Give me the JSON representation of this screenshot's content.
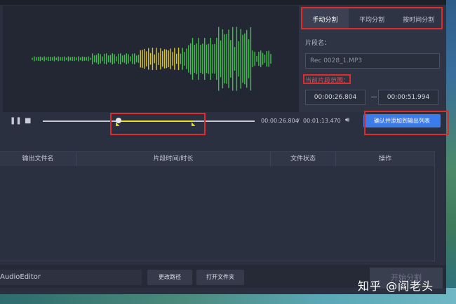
{
  "tabs": [
    {
      "label": "手动分割",
      "active": true
    },
    {
      "label": "平均分割",
      "active": false
    },
    {
      "label": "按时间分割",
      "active": false
    }
  ],
  "segment": {
    "name_label": "片段名：",
    "name_value": "Rec 0028_1.MP3",
    "range_label": "当前片段范围：",
    "start_time": "00:00:26.804",
    "end_time": "00:00:51.994"
  },
  "player": {
    "pause_icon": "pause-icon",
    "stop_icon": "stop-icon",
    "volume_icon": "volume-icon",
    "current_time": "00:00:26.804",
    "separator": "/",
    "total_time": "00:01:13.470",
    "progress_fraction": 0.36,
    "selection_start_fraction": 0.36,
    "selection_end_fraction": 0.7,
    "confirm_label": "确认并添加到输出列表"
  },
  "table": {
    "columns": [
      "输出文件名",
      "片段时间/时长",
      "文件状态",
      "操作"
    ],
    "rows": []
  },
  "bottom": {
    "path_value": "AudioEditor",
    "change_path_label": "更改路径",
    "open_folder_label": "打开文件夹",
    "start_label": "开始分割"
  },
  "watermark": "知乎 @阎老头",
  "colors": {
    "accent": "#3c7bea",
    "highlight": "#e12b2b",
    "selection": "#f0e020",
    "wave_green": "#3ec24a",
    "wave_yellow": "#d6c22a"
  }
}
